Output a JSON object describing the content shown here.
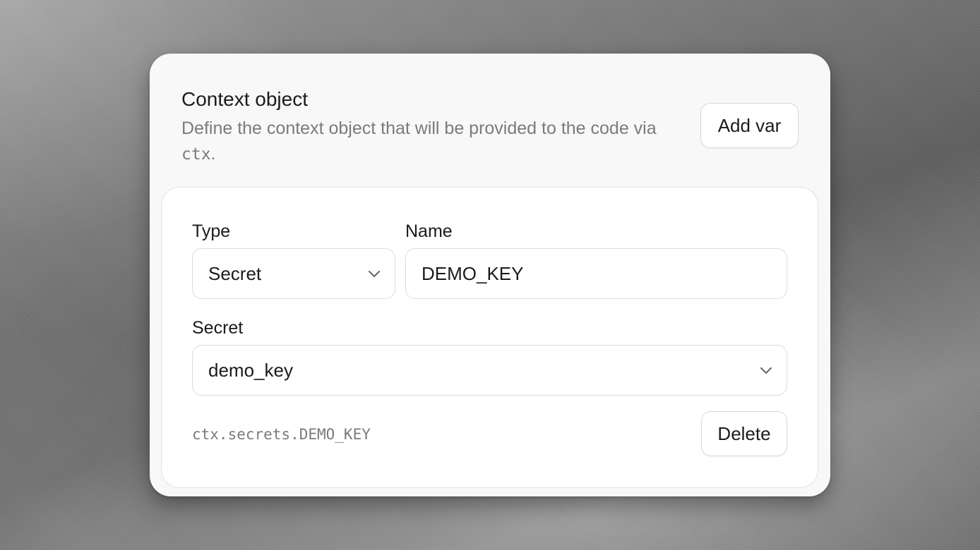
{
  "context": {
    "title": "Context object",
    "description_prefix": "Define the context object that will be provided to the code via ",
    "description_code": "ctx",
    "description_suffix": ".",
    "add_var_label": "Add var"
  },
  "variable": {
    "type_label": "Type",
    "type_value": "Secret",
    "name_label": "Name",
    "name_value": "DEMO_KEY",
    "secret_label": "Secret",
    "secret_value": "demo_key",
    "access_path": "ctx.secrets.DEMO_KEY",
    "delete_label": "Delete"
  },
  "icons": {
    "dropdown": "chevron-down-icon"
  },
  "colors": {
    "card_bg": "#f8f8f8",
    "panel_bg": "#ffffff",
    "text_primary": "#1b1b1b",
    "text_muted": "#7b7b7b",
    "border": "#dcdcdc"
  }
}
